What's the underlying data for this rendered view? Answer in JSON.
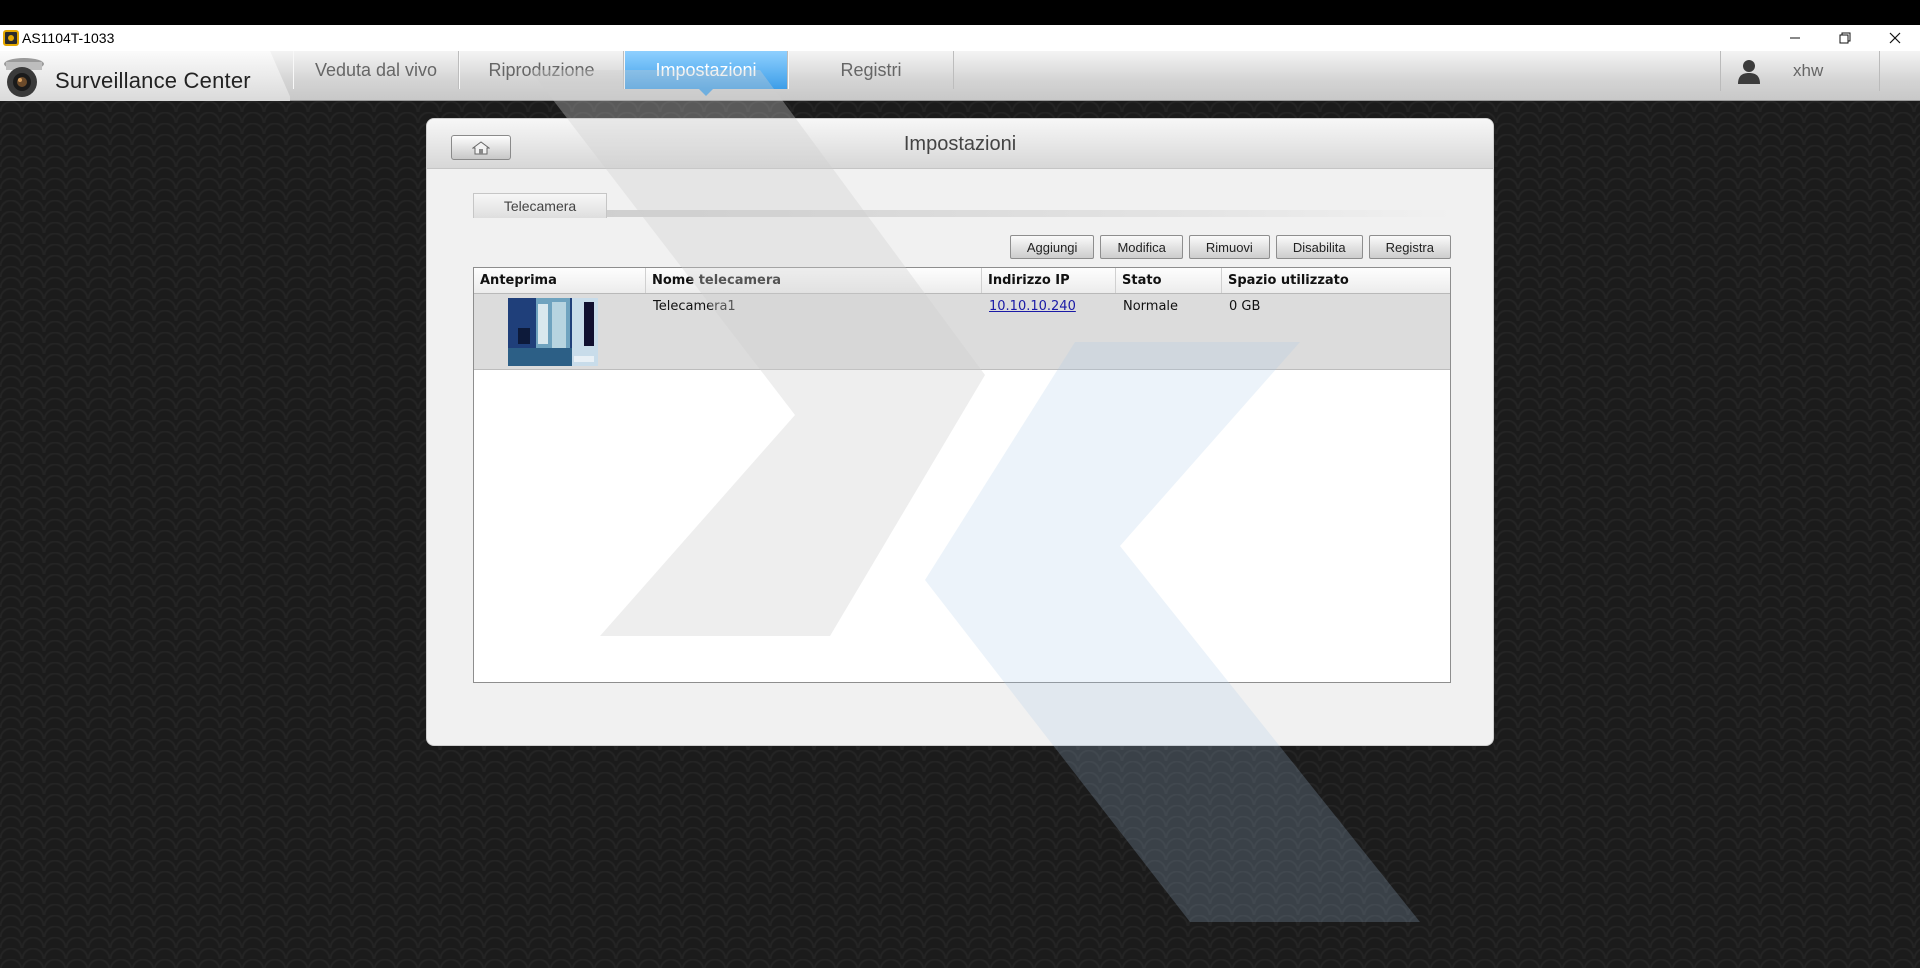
{
  "window": {
    "title": "AS1104T-1033",
    "controls": {
      "minimize": "—",
      "restore": "❐",
      "close": "✕"
    }
  },
  "navbar": {
    "brand": "Surveillance Center",
    "tabs": [
      {
        "label": "Veduta dal vivo",
        "active": false
      },
      {
        "label": "Riproduzione",
        "active": false
      },
      {
        "label": "Impostazioni",
        "active": true
      },
      {
        "label": "Registri",
        "active": false
      }
    ],
    "user": "xhw",
    "active_color": "#3d9ee8"
  },
  "panel": {
    "title": "Impostazioni",
    "subtab": "Telecamera",
    "actions": {
      "add": "Aggiungi",
      "edit": "Modifica",
      "remove": "Rimuovi",
      "disable": "Disabilita",
      "record": "Registra"
    },
    "table": {
      "headers": [
        "Anteprima",
        "Nome telecamera",
        "Indirizzo IP",
        "Stato",
        "Spazio utilizzato"
      ],
      "rows": [
        {
          "name": "Telecamera1",
          "ip": "10.10.10.240",
          "status": "Normale",
          "space": "0 GB"
        }
      ]
    }
  },
  "icons": [
    "app-icon",
    "camera-logo-icon",
    "user-icon",
    "home-icon",
    "camera-thumbnail"
  ]
}
